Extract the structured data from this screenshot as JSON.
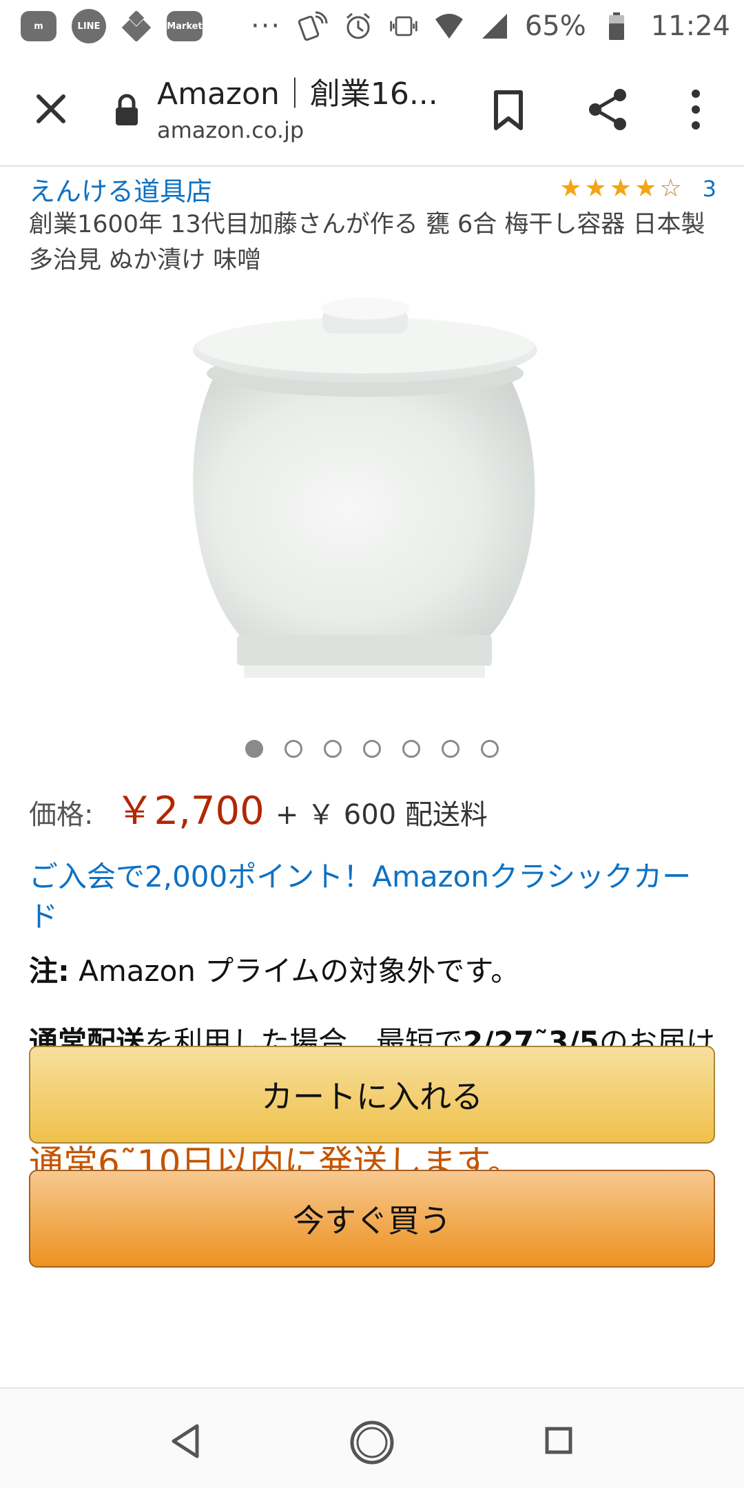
{
  "status_bar": {
    "app_icons": [
      "m",
      "LINE",
      "",
      "Market"
    ],
    "overflow": "···",
    "battery_percent": "65%",
    "time": "11:24"
  },
  "browser": {
    "page_title": "Amazon｜創業16...",
    "url": "amazon.co.jp"
  },
  "product": {
    "brand": "えんける道具店",
    "rating_count": "3",
    "rating_stars": 4,
    "rating_max": 5,
    "title": "創業1600年 13代目加藤さんが作る 甕 6合 梅干し容器 日本製 多治見 ぬか漬け 味噌",
    "image_count": 7,
    "image_active": 0,
    "price_label": "価格:",
    "price": "￥2,700",
    "shipping": "+ ￥ 600 配送料",
    "promo": "ご入会で2,000ポイント！Amazonクラシックカード",
    "note_label": "注:",
    "note_text": " Amazon プライムの対象外です。",
    "delivery_bold1": "通常配送",
    "delivery_text1": "を利用した場合、最短で",
    "delivery_bold2": "2/27˜3/5",
    "delivery_text2": "のお届け予定です。",
    "ship_time": "通常6˜10日以内に発送します。",
    "add_to_cart": "カートに入れる",
    "buy_now": "今すぐ買う"
  },
  "colors": {
    "link": "#0c71c4",
    "price": "#b12704",
    "ship_time": "#c45500",
    "star": "#f3a517",
    "cart_button": "#f0c14b",
    "buy_button": "#ed9220"
  }
}
